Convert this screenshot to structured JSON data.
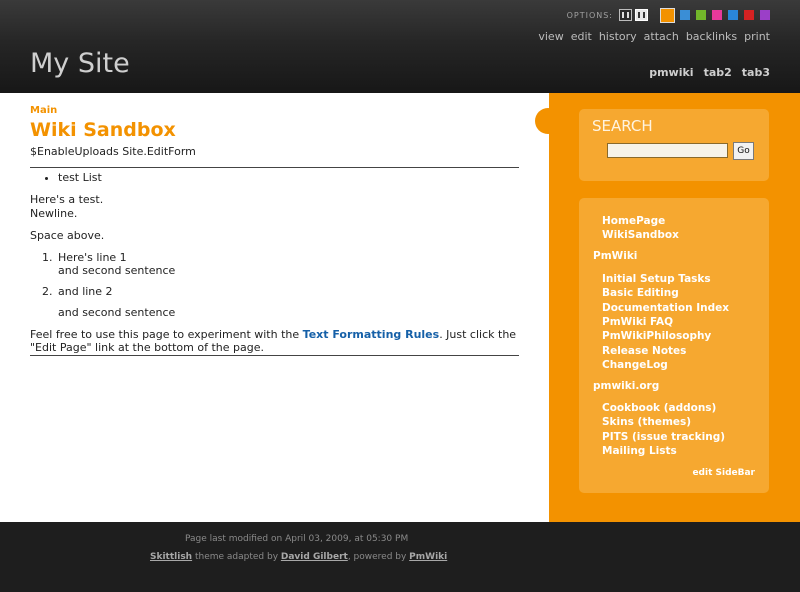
{
  "header": {
    "options_label": "OPTIONS:",
    "swatches": [
      "#f39200",
      "#3a8ed6",
      "#72b62a",
      "#e8399b",
      "#2a86d8",
      "#d52222",
      "#9b3fc8"
    ],
    "actions": [
      "view",
      "edit",
      "history",
      "attach",
      "backlinks",
      "print"
    ],
    "site_title": "My Site",
    "tabs": [
      "pmwiki",
      "tab2",
      "tab3"
    ]
  },
  "main": {
    "group": "Main",
    "title": "Wiki Sandbox",
    "directives": "$EnableUploads Site.EditForm",
    "bullet_item": "test List",
    "p1_line1": "Here's a test.",
    "p1_line2": "Newline.",
    "p2": "Space above.",
    "ol1_num": "1.",
    "ol1_line1": "Here's line 1",
    "ol1_line2": "and second sentence",
    "ol2_num": "2.",
    "ol2_line1": "and line 2",
    "ol_tail": "and second sentence",
    "p3_before": "Feel free to use this page to experiment with the ",
    "p3_link": "Text Formatting Rules",
    "p3_after": ". Just click the \"Edit Page\" link at the bottom of the page."
  },
  "sidebar": {
    "search_heading": "SEARCH",
    "search_button": "Go",
    "links_top": [
      "HomePage",
      "WikiSandbox"
    ],
    "heading_pmwiki": "PmWiki",
    "links_pmwiki": [
      "Initial Setup Tasks",
      "Basic Editing",
      "Documentation Index",
      "PmWiki FAQ",
      "PmWikiPhilosophy",
      "Release Notes",
      "ChangeLog"
    ],
    "heading_pmwikiorg": "pmwiki.org",
    "links_pmwikiorg": [
      "Cookbook (addons)",
      "Skins (themes)",
      "PITS (issue tracking)",
      "Mailing Lists"
    ],
    "edit_sidebar": "edit SideBar"
  },
  "footer": {
    "modified": "Page last modified on April 03, 2009, at 05:30 PM",
    "skin_link": "Skittlish",
    "text1": " theme adapted by ",
    "author_link": "David Gilbert",
    "text2": ", powered by ",
    "pmwiki_link": "PmWiki"
  }
}
